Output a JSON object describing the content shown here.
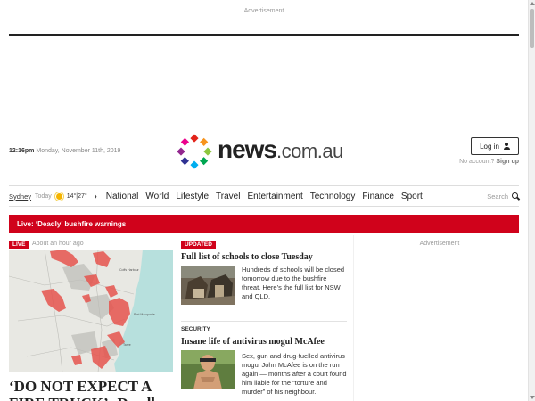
{
  "advertisement_label": "Advertisement",
  "header": {
    "time": "12:16pm",
    "date": "Monday, November 11th, 2019",
    "logo_main": "news",
    "logo_tld": ".com.au",
    "login_label": "Log in",
    "no_account_text": "No account?",
    "signup_label": "Sign up"
  },
  "weather": {
    "city": "Sydney",
    "day": "Today",
    "temps": "14°|27°",
    "icon": "sun-icon"
  },
  "nav": {
    "items": [
      "National",
      "World",
      "Lifestyle",
      "Travel",
      "Entertainment",
      "Technology",
      "Finance",
      "Sport"
    ],
    "search_label": "Search"
  },
  "live_banner": "Live: ‘Deadly’ bushfire warnings",
  "hero": {
    "badge": "LIVE",
    "time": "About an hour ago",
    "headline": "‘DO NOT EXPECT A FIRE TRUCK’: Deadly"
  },
  "stories": [
    {
      "tag": "UPDATED",
      "headline": "Full list of schools to close Tuesday",
      "summary": "Hundreds of schools will be closed tomorrow due to the bushfire threat. Here’s the full list for NSW and QLD."
    },
    {
      "category": "SECURITY",
      "headline": "Insane life of antivirus mogul McAfee",
      "summary": "Sex, gun and drug-fuelled antivirus mogul John McAfee is on the run again — months after a court found him liable for the “torture and murder” of his neighbour."
    }
  ],
  "sidebar": {
    "ad_label": "Advertisement"
  },
  "colors": {
    "accent_red": "#d0021b",
    "logo_dots": [
      "#e2231a",
      "#f7941d",
      "#8dc63f",
      "#00a651",
      "#00aeef",
      "#2e3192",
      "#92278f",
      "#ec008c"
    ]
  }
}
